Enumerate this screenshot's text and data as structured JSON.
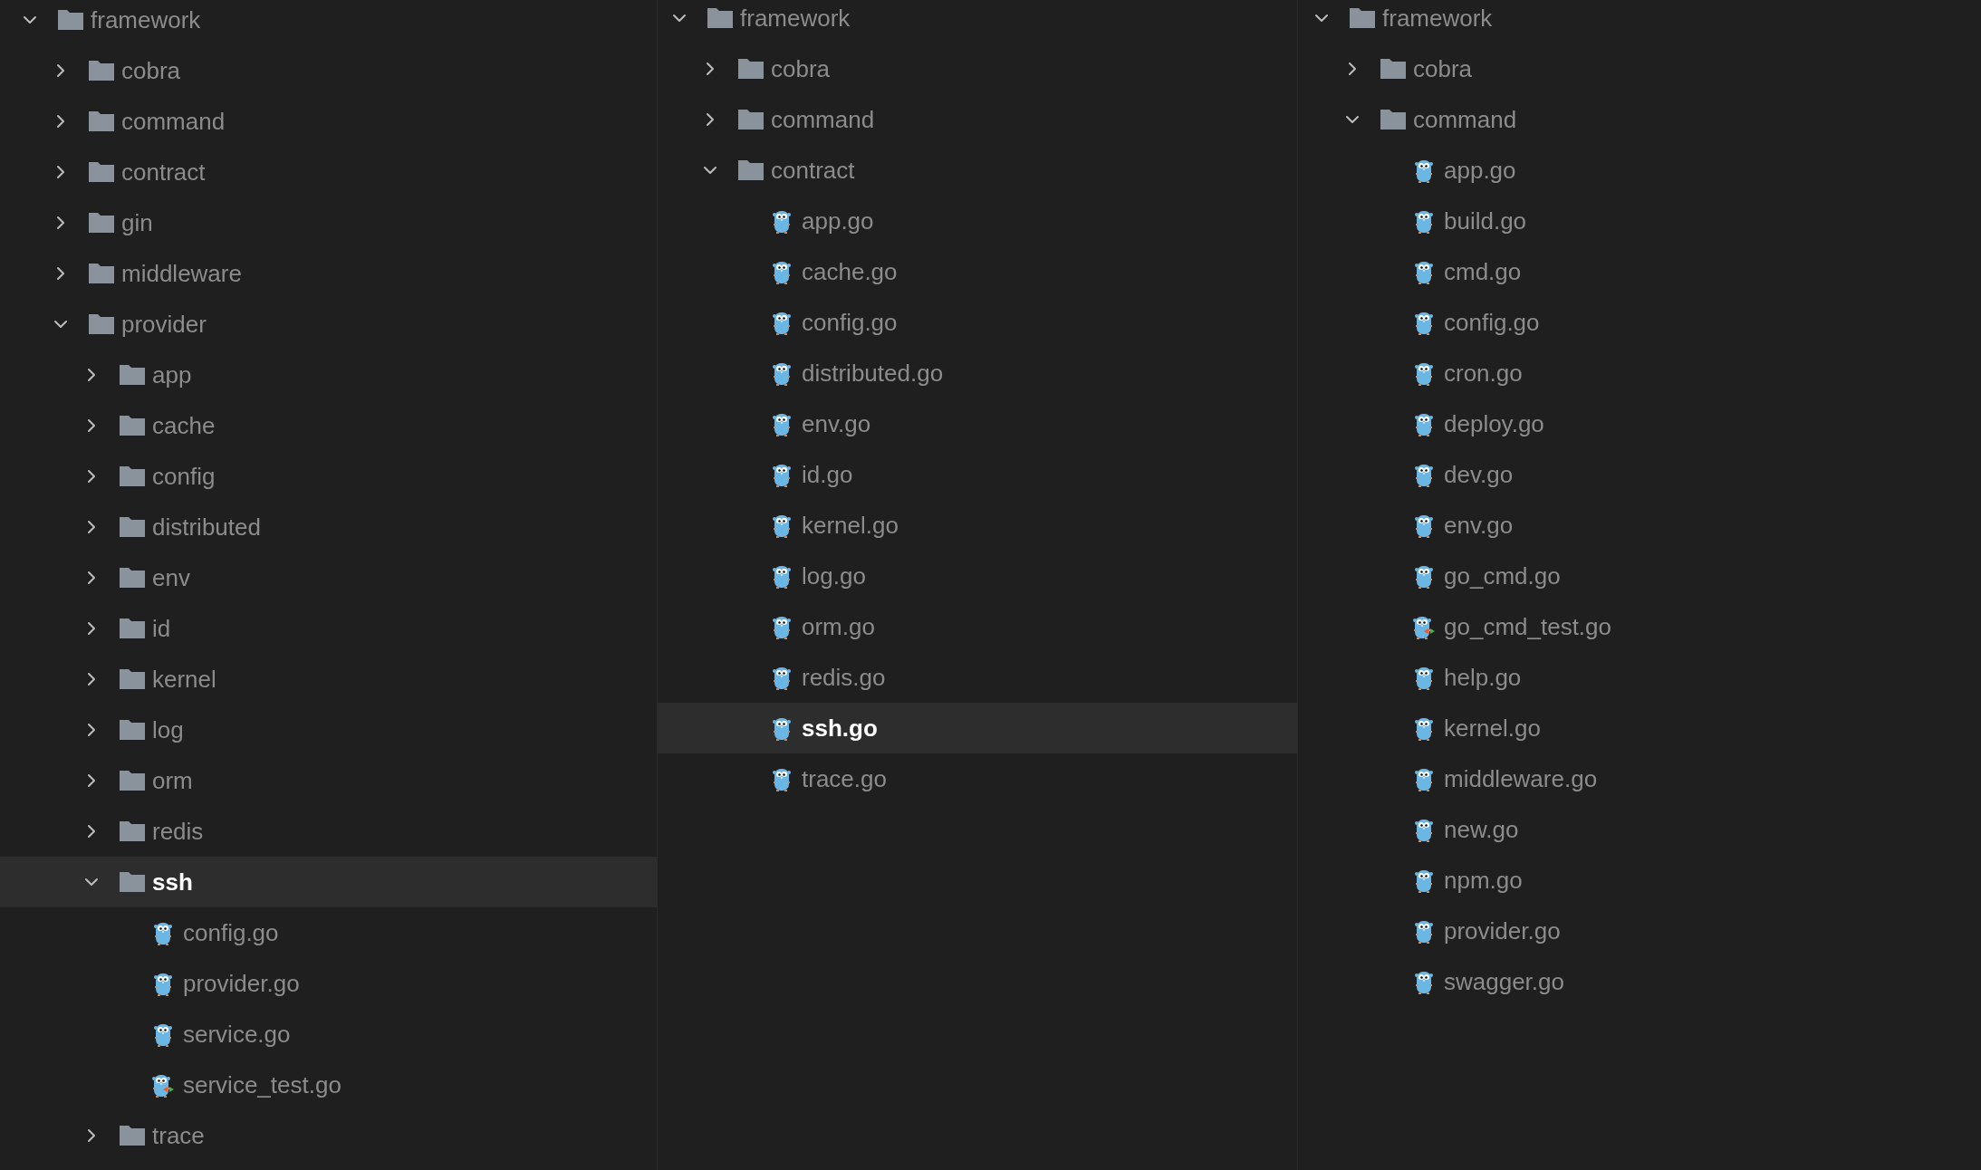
{
  "panels": [
    {
      "tree": [
        {
          "name": "framework",
          "kind": "folder",
          "expanded": true,
          "selected": false,
          "children": [
            {
              "name": "cobra",
              "kind": "folder",
              "expanded": false,
              "selected": false
            },
            {
              "name": "command",
              "kind": "folder",
              "expanded": false,
              "selected": false
            },
            {
              "name": "contract",
              "kind": "folder",
              "expanded": false,
              "selected": false
            },
            {
              "name": "gin",
              "kind": "folder",
              "expanded": false,
              "selected": false
            },
            {
              "name": "middleware",
              "kind": "folder",
              "expanded": false,
              "selected": false
            },
            {
              "name": "provider",
              "kind": "folder",
              "expanded": true,
              "selected": false,
              "children": [
                {
                  "name": "app",
                  "kind": "folder",
                  "expanded": false,
                  "selected": false
                },
                {
                  "name": "cache",
                  "kind": "folder",
                  "expanded": false,
                  "selected": false
                },
                {
                  "name": "config",
                  "kind": "folder",
                  "expanded": false,
                  "selected": false
                },
                {
                  "name": "distributed",
                  "kind": "folder",
                  "expanded": false,
                  "selected": false
                },
                {
                  "name": "env",
                  "kind": "folder",
                  "expanded": false,
                  "selected": false
                },
                {
                  "name": "id",
                  "kind": "folder",
                  "expanded": false,
                  "selected": false
                },
                {
                  "name": "kernel",
                  "kind": "folder",
                  "expanded": false,
                  "selected": false
                },
                {
                  "name": "log",
                  "kind": "folder",
                  "expanded": false,
                  "selected": false
                },
                {
                  "name": "orm",
                  "kind": "folder",
                  "expanded": false,
                  "selected": false
                },
                {
                  "name": "redis",
                  "kind": "folder",
                  "expanded": false,
                  "selected": false
                },
                {
                  "name": "ssh",
                  "kind": "folder",
                  "expanded": true,
                  "selected": true,
                  "children": [
                    {
                      "name": "config.go",
                      "kind": "file",
                      "selected": false
                    },
                    {
                      "name": "provider.go",
                      "kind": "file",
                      "selected": false
                    },
                    {
                      "name": "service.go",
                      "kind": "file",
                      "selected": false
                    },
                    {
                      "name": "service_test.go",
                      "kind": "test",
                      "selected": false
                    }
                  ]
                },
                {
                  "name": "trace",
                  "kind": "folder",
                  "expanded": false,
                  "selected": false
                }
              ]
            }
          ]
        }
      ]
    },
    {
      "tree": [
        {
          "name": "framework",
          "kind": "folder",
          "expanded": true,
          "selected": false,
          "children": [
            {
              "name": "cobra",
              "kind": "folder",
              "expanded": false,
              "selected": false
            },
            {
              "name": "command",
              "kind": "folder",
              "expanded": false,
              "selected": false
            },
            {
              "name": "contract",
              "kind": "folder",
              "expanded": true,
              "selected": false,
              "children": [
                {
                  "name": "app.go",
                  "kind": "file",
                  "selected": false
                },
                {
                  "name": "cache.go",
                  "kind": "file",
                  "selected": false
                },
                {
                  "name": "config.go",
                  "kind": "file",
                  "selected": false
                },
                {
                  "name": "distributed.go",
                  "kind": "file",
                  "selected": false
                },
                {
                  "name": "env.go",
                  "kind": "file",
                  "selected": false
                },
                {
                  "name": "id.go",
                  "kind": "file",
                  "selected": false
                },
                {
                  "name": "kernel.go",
                  "kind": "file",
                  "selected": false
                },
                {
                  "name": "log.go",
                  "kind": "file",
                  "selected": false
                },
                {
                  "name": "orm.go",
                  "kind": "file",
                  "selected": false
                },
                {
                  "name": "redis.go",
                  "kind": "file",
                  "selected": false
                },
                {
                  "name": "ssh.go",
                  "kind": "file",
                  "selected": true
                },
                {
                  "name": "trace.go",
                  "kind": "file",
                  "selected": false
                }
              ]
            }
          ]
        }
      ]
    },
    {
      "tree": [
        {
          "name": "framework",
          "kind": "folder",
          "expanded": true,
          "selected": false,
          "children": [
            {
              "name": "cobra",
              "kind": "folder",
              "expanded": false,
              "selected": false
            },
            {
              "name": "command",
              "kind": "folder",
              "expanded": true,
              "selected": false,
              "children": [
                {
                  "name": "app.go",
                  "kind": "file",
                  "selected": false
                },
                {
                  "name": "build.go",
                  "kind": "file",
                  "selected": false
                },
                {
                  "name": "cmd.go",
                  "kind": "file",
                  "selected": false
                },
                {
                  "name": "config.go",
                  "kind": "file",
                  "selected": false
                },
                {
                  "name": "cron.go",
                  "kind": "file",
                  "selected": false
                },
                {
                  "name": "deploy.go",
                  "kind": "file",
                  "selected": false
                },
                {
                  "name": "dev.go",
                  "kind": "file",
                  "selected": false
                },
                {
                  "name": "env.go",
                  "kind": "file",
                  "selected": false
                },
                {
                  "name": "go_cmd.go",
                  "kind": "file",
                  "selected": false
                },
                {
                  "name": "go_cmd_test.go",
                  "kind": "test",
                  "selected": false
                },
                {
                  "name": "help.go",
                  "kind": "file",
                  "selected": false
                },
                {
                  "name": "kernel.go",
                  "kind": "file",
                  "selected": false
                },
                {
                  "name": "middleware.go",
                  "kind": "file",
                  "selected": false
                },
                {
                  "name": "new.go",
                  "kind": "file",
                  "selected": false
                },
                {
                  "name": "npm.go",
                  "kind": "file",
                  "selected": false
                },
                {
                  "name": "provider.go",
                  "kind": "file",
                  "selected": false
                },
                {
                  "name": "swagger.go",
                  "kind": "file",
                  "selected": false
                }
              ]
            }
          ]
        }
      ]
    }
  ]
}
